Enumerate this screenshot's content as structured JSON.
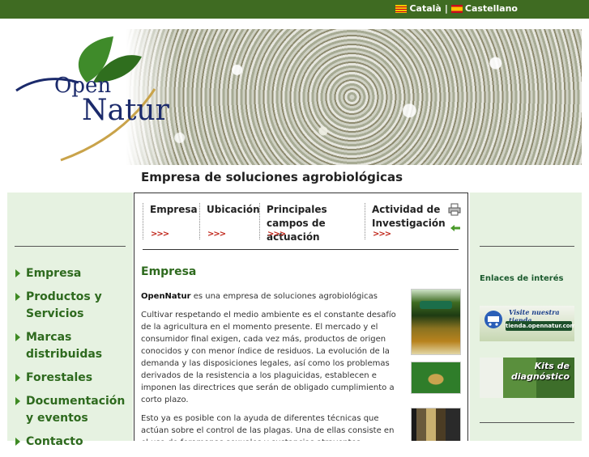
{
  "header": {
    "languages": [
      {
        "label": "Català",
        "flag": "catalonia-flag-icon"
      },
      {
        "label": "Castellano",
        "flag": "spain-flag-icon"
      }
    ],
    "separator": "|"
  },
  "logo": {
    "line1": "Open",
    "line2": "Natur"
  },
  "tagline": "Empresa de soluciones agrobiológicas",
  "sidebar": {
    "items": [
      {
        "label": "Empresa"
      },
      {
        "label": "Productos y Servicios"
      },
      {
        "label": "Marcas distribuidas"
      },
      {
        "label": "Forestales"
      },
      {
        "label": "Documentación y eventos"
      },
      {
        "label": "Contacto"
      }
    ]
  },
  "tabs": [
    {
      "label": "Empresa",
      "arrows": ">>>"
    },
    {
      "label": "Ubicación",
      "arrows": ">>>"
    },
    {
      "label": "Principales campos de actuación",
      "arrows": ">>>"
    },
    {
      "label": "Actividad de Investigación",
      "arrows": ">>>"
    }
  ],
  "main": {
    "section_title": "Empresa",
    "intro_bold": "OpenNatur",
    "intro_rest": " es una empresa de soluciones agrobiológicas",
    "para1": "Cultivar respetando el medio ambiente es el constante desafío de la agricultura en el momento presente. El mercado y el consumidor final exigen, cada vez más, productos de origen conocidos y con menor índice de residuos. La evolución de la demanda y las disposiciones legales, así como los problemas derivados de la resistencia a los plaguicidas, establecen e imponen las directrices que serán de obligado cumplimiento a corto plazo.",
    "para2": "Esto ya es posible con la ayuda de diferentes técnicas que actúan sobre el control de las plagas. Una de ellas consiste en el uso de feromonas sexuales y sustancias atrayentes sintetizadas, junto con diferentes trampas específicas y distribuidas estratégicamente en los cultivos."
  },
  "rightbar": {
    "links_title": "Enlaces de interés",
    "shop_top": "Visite nuestra tienda",
    "shop_url": "tienda.opennatur.com",
    "kits_label": "Kits de diagnóstico"
  },
  "colors": {
    "topbar": "#3f6b22",
    "nav_green": "#2e6a1e",
    "sidebar_bg": "#e6f2e1",
    "arrows_red": "#c0261a"
  }
}
